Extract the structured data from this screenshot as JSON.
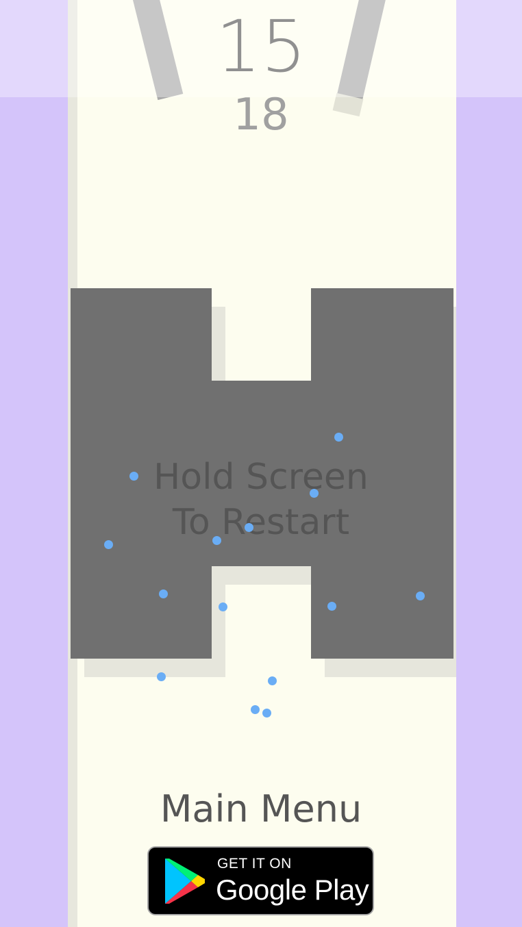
{
  "score": "15",
  "best_score": "18",
  "restart_message": {
    "line1": "Hold Screen",
    "line2": "To Restart"
  },
  "main_menu_label": "Main Menu",
  "store_badge": {
    "small_text": "GET IT ON",
    "big_text": "Google Play",
    "icon": "google-play-icon"
  },
  "colors": {
    "background": "#d4c4fa",
    "lane": "#fdfdef",
    "obstacle": "#707070",
    "particle": "#6aadf5",
    "text": "#555555"
  }
}
